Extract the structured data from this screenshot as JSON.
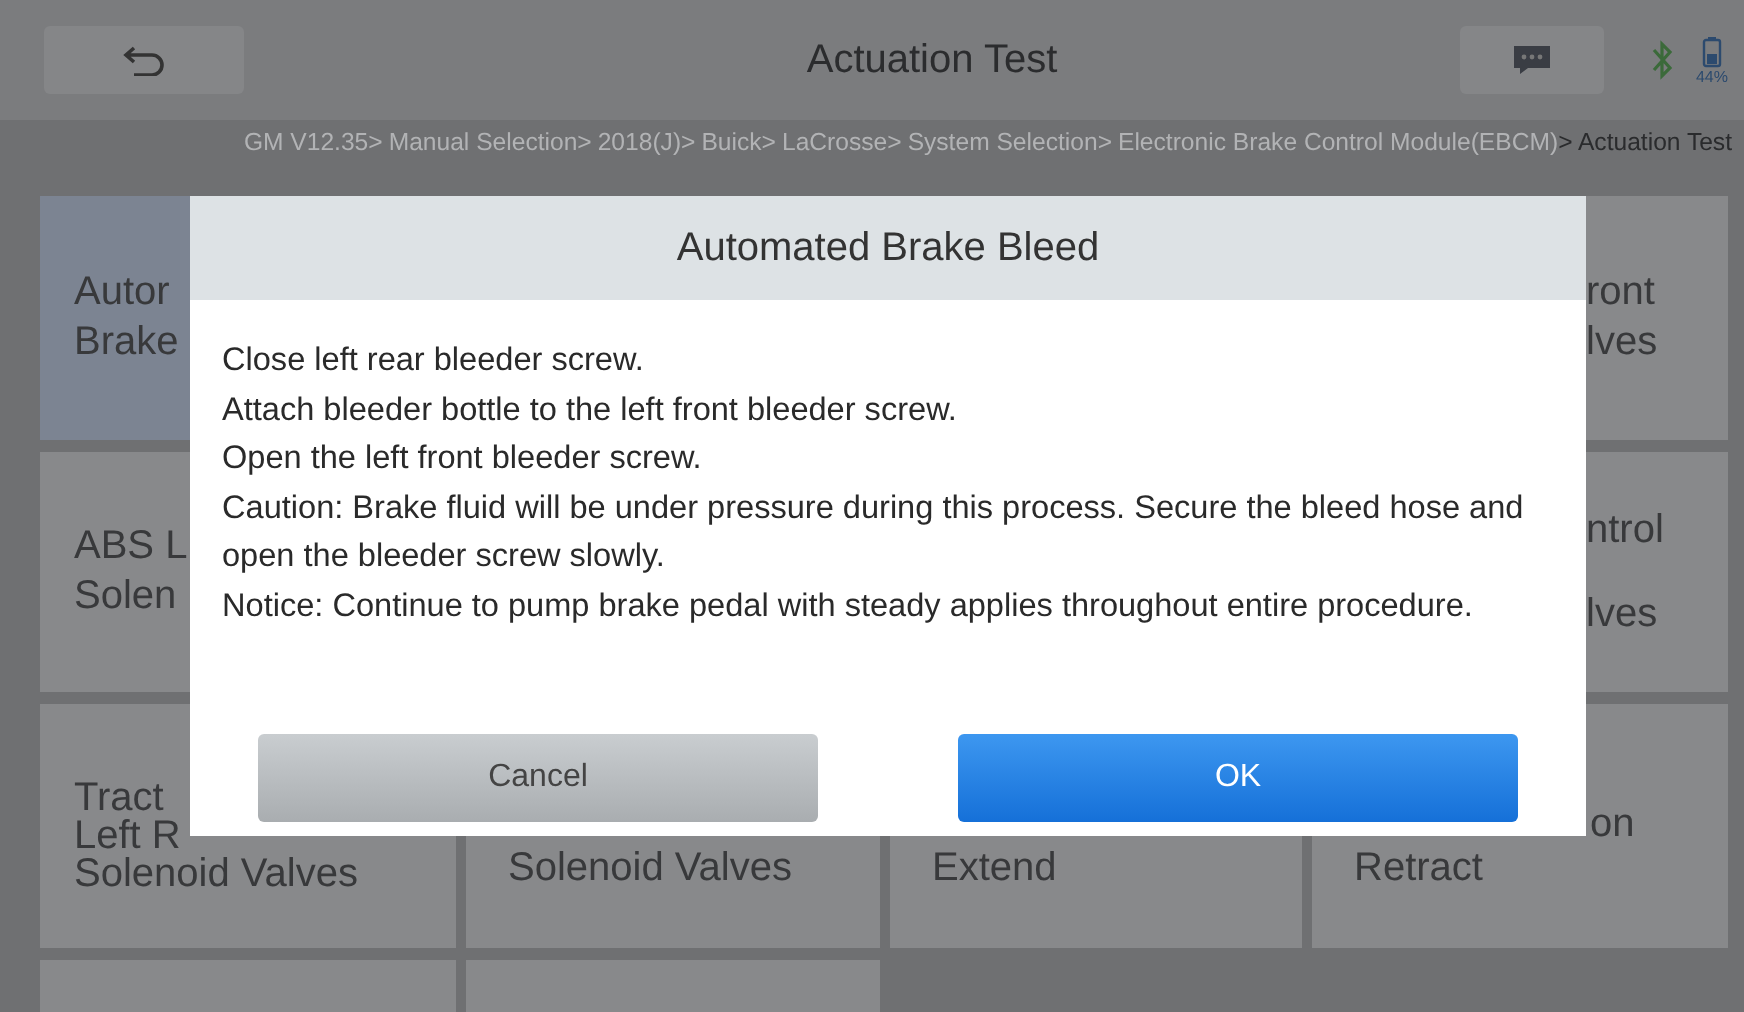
{
  "header": {
    "title": "Actuation Test",
    "battery": "44%"
  },
  "breadcrumb": [
    {
      "label": "GM V12.35>",
      "current": false
    },
    {
      "label": "Manual Selection>",
      "current": false
    },
    {
      "label": "2018(J)>",
      "current": false
    },
    {
      "label": "Buick>",
      "current": false
    },
    {
      "label": "LaCrosse>",
      "current": false
    },
    {
      "label": "System Selection>",
      "current": false
    },
    {
      "label": "Electronic Brake Control Module(EBCM)",
      "current": false
    },
    {
      "label": "> Actuation Test",
      "current": true
    }
  ],
  "tiles": [
    {
      "lines": [
        "Autor",
        "Brake"
      ],
      "selected": true
    },
    {
      "lines": [
        "ront",
        "lves"
      ],
      "selected": false
    },
    {
      "lines": [
        "ABS L",
        "Solen"
      ],
      "selected": false
    },
    {
      "lines": [
        "ntrol",
        "lves"
      ],
      "selected": false
    },
    {
      "lines": [
        "Tract",
        "Left R",
        "Solenoid Valves"
      ],
      "selected": false
    },
    {
      "lines": [
        "Solenoid Valves"
      ],
      "selected": false
    },
    {
      "lines": [
        "Extend"
      ],
      "selected": false
    },
    {
      "lines": [
        "on",
        "Retract"
      ],
      "selected": false
    },
    {
      "selected": false
    },
    {
      "selected": false
    }
  ],
  "dialog": {
    "title": "Automated Brake Bleed",
    "message": [
      "Close left rear bleeder screw.",
      "Attach bleeder bottle to the left front bleeder screw.",
      "Open the left front bleeder screw.",
      "Caution: Brake fluid will be under pressure during this process. Secure the bleed hose and open the bleeder screw slowly.",
      "Notice: Continue to pump brake pedal with steady applies throughout entire procedure."
    ],
    "buttons": [
      {
        "label": "Cancel",
        "kind": "secondary"
      },
      {
        "label": "OK",
        "kind": "primary"
      }
    ]
  }
}
